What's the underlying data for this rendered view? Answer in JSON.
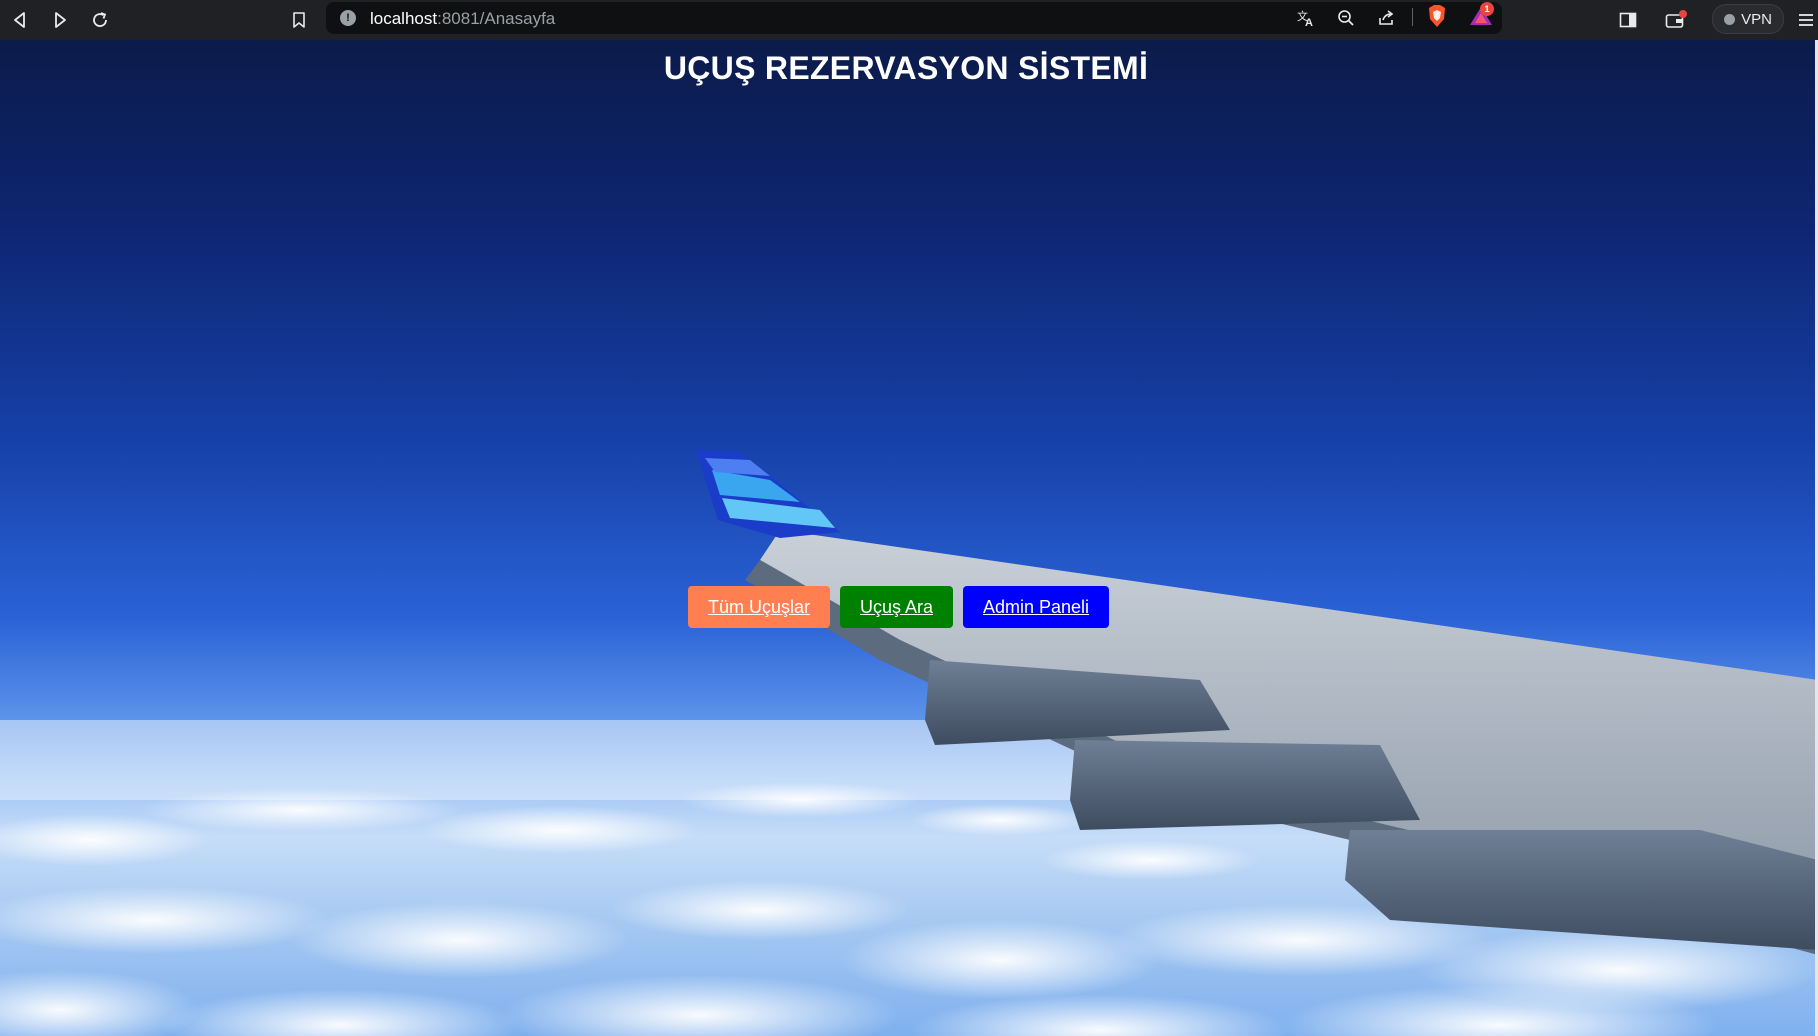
{
  "browser": {
    "url_host": "localhost",
    "url_rest": ":8081/Anasayfa",
    "rewards_badge": "1",
    "vpn_label": "VPN",
    "icons": [
      "back-icon",
      "forward-icon",
      "reload-icon",
      "bookmark-icon",
      "site-info-icon",
      "translate-icon",
      "zoom-out-icon",
      "share-icon",
      "brave-shield-icon",
      "brave-rewards-icon",
      "sidebar-icon",
      "wallet-icon",
      "vpn-icon",
      "menu-icon"
    ]
  },
  "page": {
    "title": "UÇUŞ REZERVASYON SİSTEMİ",
    "buttons": [
      {
        "label": "Tüm Uçuşlar",
        "color": "#ff7f50"
      },
      {
        "label": "Uçuş Ara",
        "color": "#008000"
      },
      {
        "label": "Admin Paneli",
        "color": "#0000ff"
      }
    ]
  }
}
